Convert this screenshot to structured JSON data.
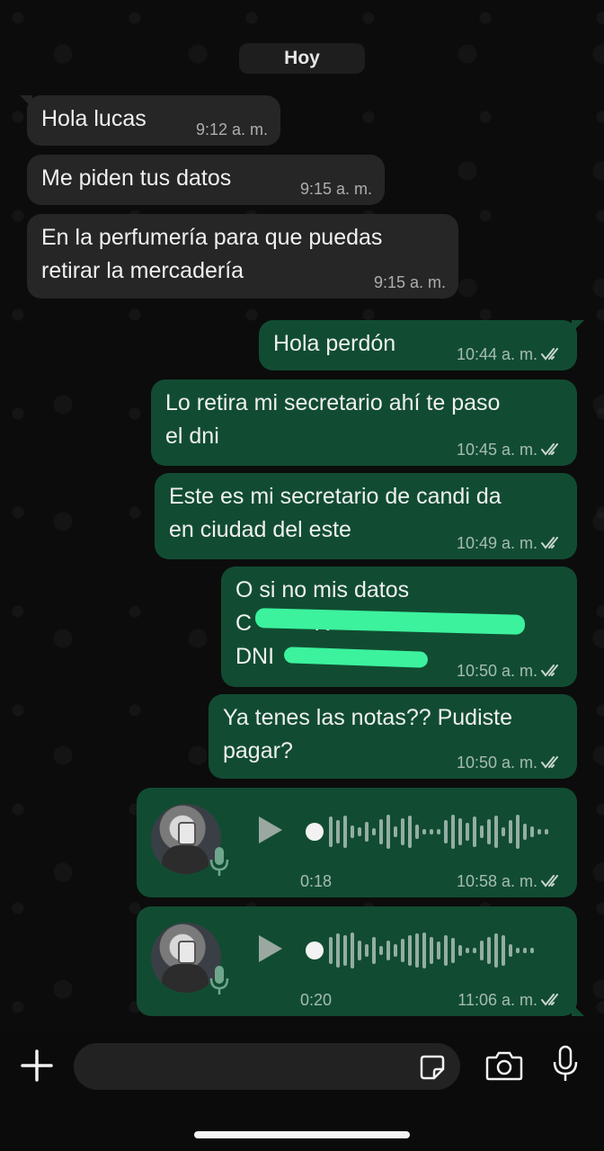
{
  "chat": {
    "date_label": "Hoy",
    "incoming": [
      {
        "text": [
          "Hola lucas"
        ],
        "time": "9:12 a. m."
      },
      {
        "text": [
          "Me piden tus datos"
        ],
        "time": "9:15 a. m."
      },
      {
        "text": [
          "En la perfumería para que puedas",
          "retirar la mercadería"
        ],
        "time": "9:15 a. m."
      }
    ],
    "outgoing": [
      {
        "text": [
          "Hola perdón"
        ],
        "time": "10:44 a. m."
      },
      {
        "text": [
          "Lo retira mi secretario ahí te paso",
          "el dni"
        ],
        "time": "10:45 a. m."
      },
      {
        "text": [
          "Este es mi secretario de candi da",
          "en ciudad del este"
        ],
        "time": "10:49 a. m."
      },
      {
        "text": [
          "O si no mis datos",
          "C          R",
          "DNI"
        ],
        "time": "10:50 a. m."
      },
      {
        "text": [
          "Ya tenes las notas?? Pudiste",
          "pagar?"
        ],
        "time": "10:50 a. m."
      }
    ],
    "voice_notes": [
      {
        "duration": "0:18",
        "time": "10:58 a. m."
      },
      {
        "duration": "0:20",
        "time": "11:06 a. m."
      }
    ]
  },
  "colors": {
    "background": "#0c0c0c",
    "incoming_bubble": "#262626",
    "outgoing_bubble": "#114c32",
    "redaction": "#3cf29d"
  },
  "icons": {
    "attach": "plus-icon",
    "sticker": "sticker-icon",
    "camera": "camera-icon",
    "voice": "microphone-icon",
    "read_receipt": "double-check-icon",
    "play": "play-icon"
  }
}
